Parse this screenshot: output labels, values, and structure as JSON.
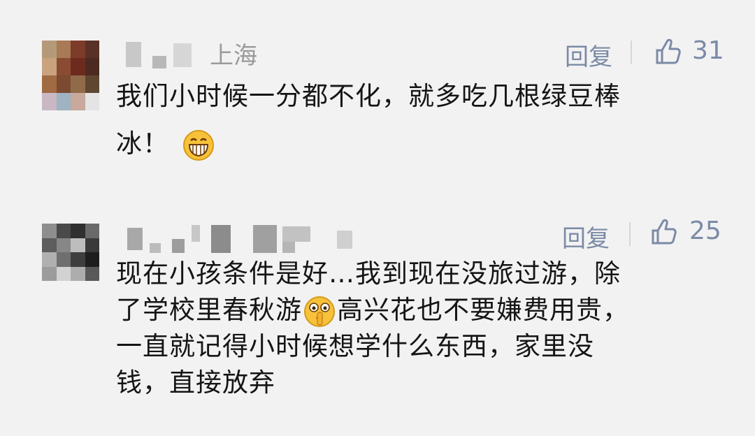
{
  "comments": [
    {
      "location": "上海",
      "reply_label": "回复",
      "like_count": "31",
      "text_lines": [
        "我们小时候一分都不化，就多吃几根绿豆棒",
        "冰！"
      ],
      "emoji": "grinning-face-emoji"
    },
    {
      "location": "",
      "reply_label": "回复",
      "like_count": "25",
      "text_lines": [
        "现在小孩条件是好…我到现在没旅过游，除",
        "了学校里春秋游",
        "高兴花也不要嫌费用贵，",
        "一直就记得小时候想学什么东西，家里没",
        "钱，直接放弃"
      ],
      "emoji": "shushing-face-emoji"
    }
  ],
  "colors": {
    "background": "#f2f2f2",
    "reply": "#7b8aa6",
    "location": "#9a9a9a",
    "text": "#151515"
  }
}
